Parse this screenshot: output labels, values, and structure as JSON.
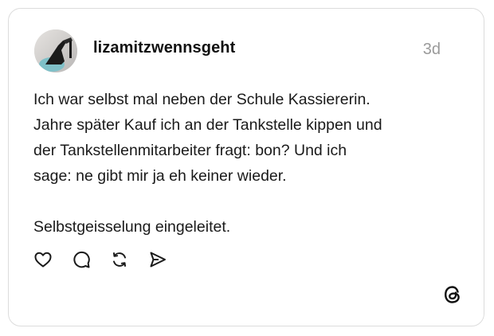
{
  "post": {
    "username": "lizamitzwennsgeht",
    "timestamp": "3d",
    "lines": [
      "Ich war selbst mal neben der Schule Kassiererin.",
      "Jahre später Kauf ich an der Tankstelle kippen und",
      "der Tankstellenmitarbeiter fragt: bon? Und ich",
      "sage: ne gibt mir ja eh keiner wieder."
    ],
    "closing": "Selbstgeisselung eingeleitet."
  },
  "actions": {
    "icons": [
      "heart-icon",
      "comment-icon",
      "repost-icon",
      "share-icon"
    ]
  },
  "branding": {
    "logo_icon": "threads-logo-icon"
  },
  "colors": {
    "border": "#dcdcdc",
    "text": "#1a1a1a",
    "muted": "#9a9a9a"
  }
}
